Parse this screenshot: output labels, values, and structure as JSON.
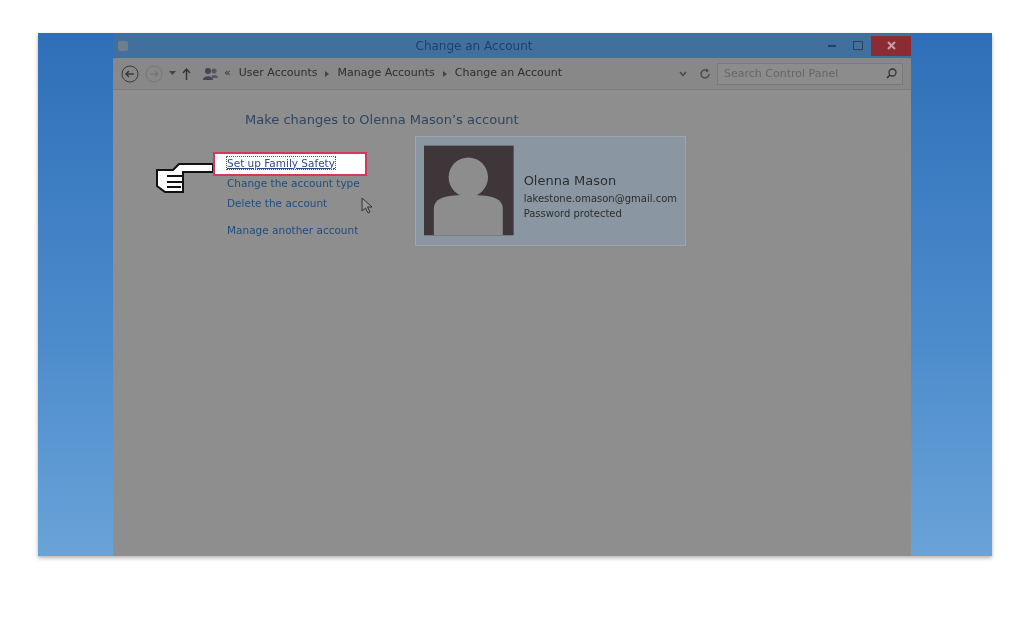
{
  "window": {
    "title": "Change an Account"
  },
  "address_bar": {
    "overflow": "«",
    "breadcrumbs": [
      "User Accounts",
      "Manage Accounts",
      "Change an Account"
    ]
  },
  "search": {
    "placeholder": "Search Control Panel"
  },
  "heading": "Make changes to Olenna Mason’s account",
  "tasks": [
    {
      "label": "Set up Family Safety",
      "highlighted": true
    },
    {
      "label": "Change the account type",
      "highlighted": false
    },
    {
      "label": "Delete the account",
      "highlighted": false
    }
  ],
  "other_links": [
    "Manage another account"
  ],
  "account": {
    "name": "Olenna Mason",
    "email": "lakestone.omason@gmail.com",
    "status": "Password protected"
  }
}
